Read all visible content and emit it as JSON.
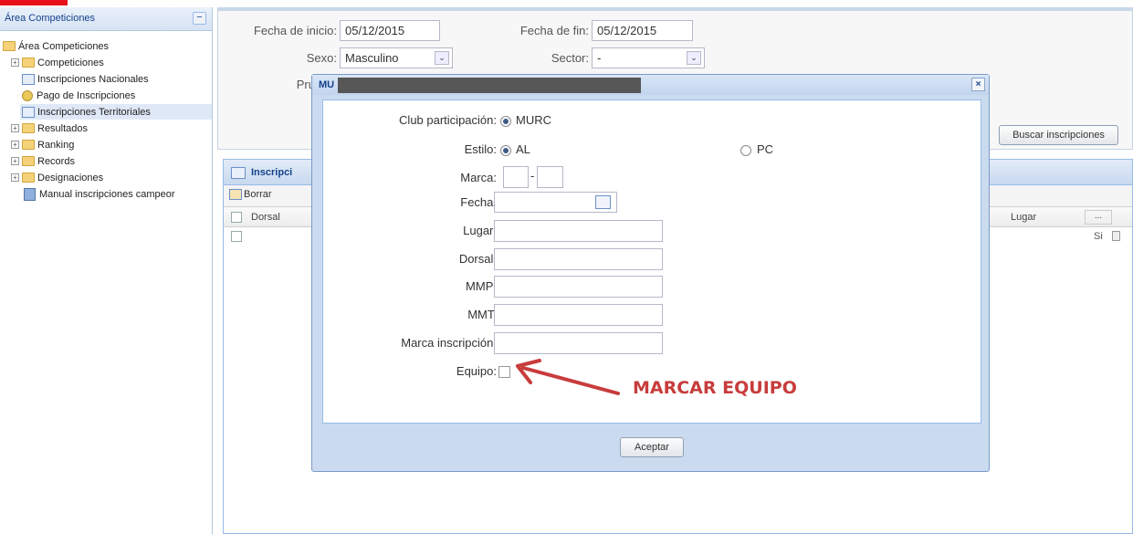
{
  "sidebar": {
    "title": "Área Competiciones",
    "collapse_glyph": "−",
    "items": [
      {
        "label": "Área Competiciones",
        "icon": "folder-open-icon"
      },
      {
        "label": "Competiciones",
        "icon": "folder-icon",
        "expander": "+"
      },
      {
        "label": "Inscripciones Nacionales",
        "icon": "grid-icon"
      },
      {
        "label": "Pago de Inscripciones",
        "icon": "coins-icon"
      },
      {
        "label": "Inscripciones Territoriales",
        "icon": "grid-icon",
        "selected": true
      },
      {
        "label": "Resultados",
        "icon": "folder-icon",
        "expander": "+"
      },
      {
        "label": "Ranking",
        "icon": "folder-icon",
        "expander": "+"
      },
      {
        "label": "Records",
        "icon": "folder-icon",
        "expander": "+"
      },
      {
        "label": "Designaciones",
        "icon": "folder-icon",
        "expander": "+"
      },
      {
        "label": "Manual inscripciones campeor",
        "icon": "manual-icon"
      }
    ]
  },
  "filters": {
    "fecha_inicio_label": "Fecha de inicio:",
    "fecha_inicio_value": "05/12/2015",
    "fecha_fin_label": "Fecha de fin:",
    "fecha_fin_value": "05/12/2015",
    "sexo_label": "Sexo:",
    "sexo_value": "Masculino",
    "sector_label": "Sector:",
    "sector_value": "-",
    "prueba_label": "Pru",
    "buscar_label": "Buscar inscripciones",
    "select_arrow": "⌄"
  },
  "grid": {
    "title": "Inscripci",
    "borrar_label": "Borrar",
    "col_dorsal": "Dorsal",
    "col_lugar": "Lugar",
    "col_more": "...",
    "row_value": "Si"
  },
  "modal": {
    "title": "MU",
    "close_glyph": "×",
    "club_label": "Club participación:",
    "club_value": "MURC",
    "estilo_label": "Estilo:",
    "estilo_al": "AL",
    "estilo_pc": "PC",
    "marca_label": "Marca:",
    "marca_sep": "-",
    "fecha_label": "Fecha:",
    "lugar_label": "Lugar:",
    "dorsal_label": "Dorsal:",
    "mmp_label": "MMP:",
    "mmt_label": "MMT:",
    "marca_inscripcion_label": "Marca inscripción:",
    "equipo_label": "Equipo:",
    "aceptar_label": "Aceptar"
  },
  "annotation": {
    "text": "MARCAR EQUIPO",
    "color": "#c83c3c"
  },
  "colors": {
    "accent": "#15428b",
    "red_bar": "#e8101a"
  }
}
